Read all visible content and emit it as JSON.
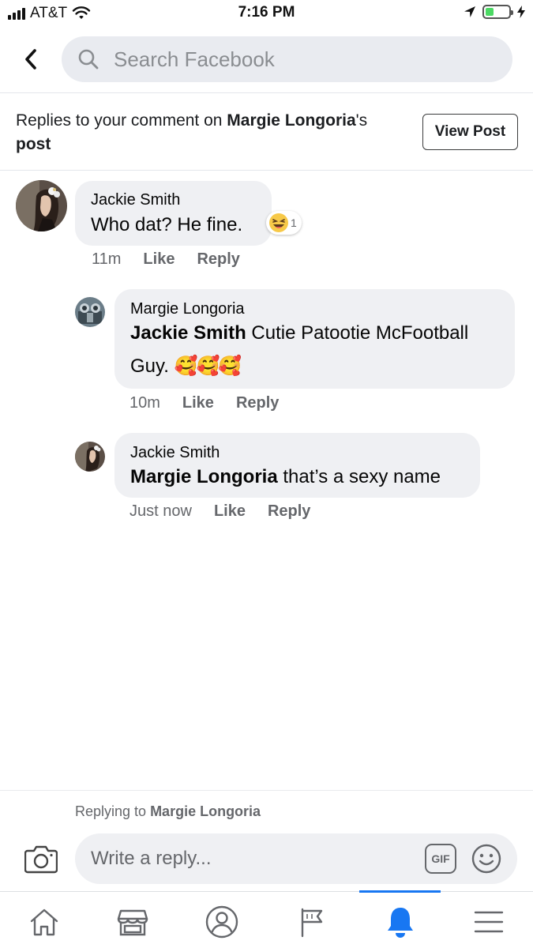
{
  "status_bar": {
    "carrier": "AT&T",
    "time": "7:16 PM",
    "signal_bars": 4,
    "battery_level": 0.35
  },
  "header": {
    "back_icon": "chevron-left-icon",
    "search_icon": "search-icon",
    "search_placeholder": "Search Facebook"
  },
  "context": {
    "prefix": "Replies to your comment on ",
    "person": "Margie Longoria",
    "suffix": "'s",
    "post_word": "post",
    "view_post_label": "View Post"
  },
  "comments": [
    {
      "author": "Jackie Smith",
      "text": "Who dat? He fine.",
      "time": "11m",
      "like": "Like",
      "reply": "Reply",
      "reaction": {
        "icon": "laughing-emoji-icon",
        "count": "1"
      }
    },
    {
      "author": "Margie Longoria",
      "mention": "Jackie Smith",
      "text": " Cutie Patootie McFootball Guy.",
      "emoji": "🥰🥰🥰",
      "time": "10m",
      "like": "Like",
      "reply": "Reply"
    },
    {
      "author": "Jackie Smith",
      "mention": "Margie Longoria",
      "text": " that’s a sexy name",
      "time": "Just now",
      "like": "Like",
      "reply": "Reply"
    }
  ],
  "composer": {
    "replying_prefix": "Replying to ",
    "replying_to": "Margie Longoria",
    "placeholder": "Write a reply...",
    "gif_label": "GIF",
    "camera_icon": "camera-icon",
    "emoji_icon": "smiley-icon"
  },
  "tabbar": {
    "tabs": [
      {
        "icon": "home-icon",
        "active": false
      },
      {
        "icon": "marketplace-icon",
        "active": false
      },
      {
        "icon": "profile-icon",
        "active": false
      },
      {
        "icon": "flag-icon",
        "active": false
      },
      {
        "icon": "bell-icon",
        "active": true
      },
      {
        "icon": "menu-icon",
        "active": false
      }
    ],
    "active_color": "#1877f2",
    "inactive_color": "#65676b"
  }
}
